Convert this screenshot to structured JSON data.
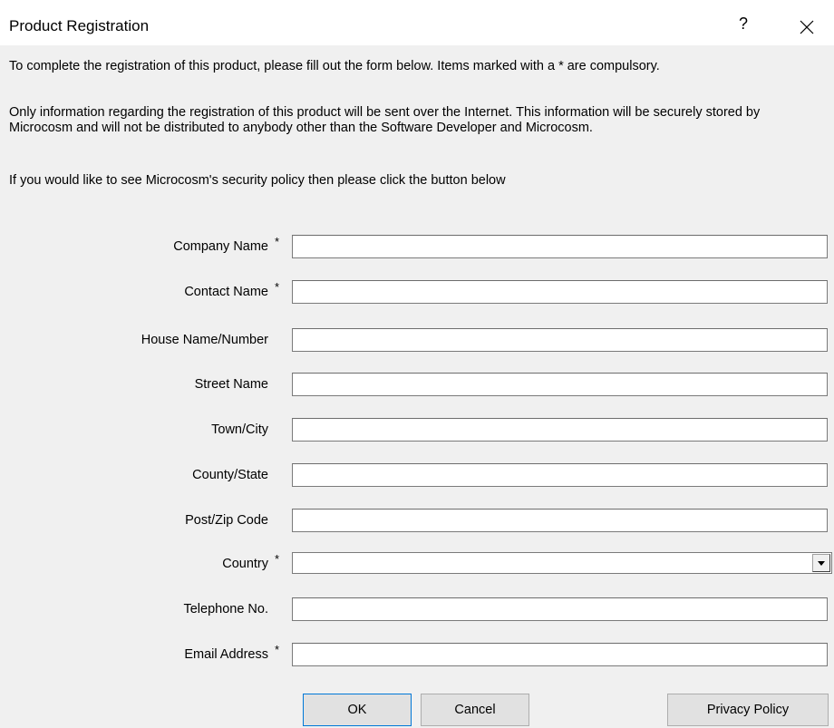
{
  "window": {
    "title": "Product Registration",
    "help_label": "?"
  },
  "intro": {
    "line1": "To complete the registration of this product, please fill out the form below. Items marked with a * are compulsory.",
    "line2": "Only information regarding the registration of this product will be sent over the Internet. This information will be securely stored by Microcosm and will not be distributed to anybody other than the Software Developer and Microcosm.",
    "line3": "If you would like to see Microcosm's security policy then please click the button below"
  },
  "form": {
    "required_marker": "*",
    "company_name": {
      "label": "Company Name",
      "value": "",
      "required": true
    },
    "contact_name": {
      "label": "Contact Name",
      "value": "",
      "required": true
    },
    "house": {
      "label": "House Name/Number",
      "value": "",
      "required": false
    },
    "street": {
      "label": "Street Name",
      "value": "",
      "required": false
    },
    "town": {
      "label": "Town/City",
      "value": "",
      "required": false
    },
    "county": {
      "label": "County/State",
      "value": "",
      "required": false
    },
    "postcode": {
      "label": "Post/Zip Code",
      "value": "",
      "required": false
    },
    "country": {
      "label": "Country",
      "value": "",
      "required": true
    },
    "telephone": {
      "label": "Telephone No.",
      "value": "",
      "required": false
    },
    "email": {
      "label": "Email Address",
      "value": "",
      "required": true
    }
  },
  "buttons": {
    "ok": "OK",
    "cancel": "Cancel",
    "privacy": "Privacy Policy"
  }
}
